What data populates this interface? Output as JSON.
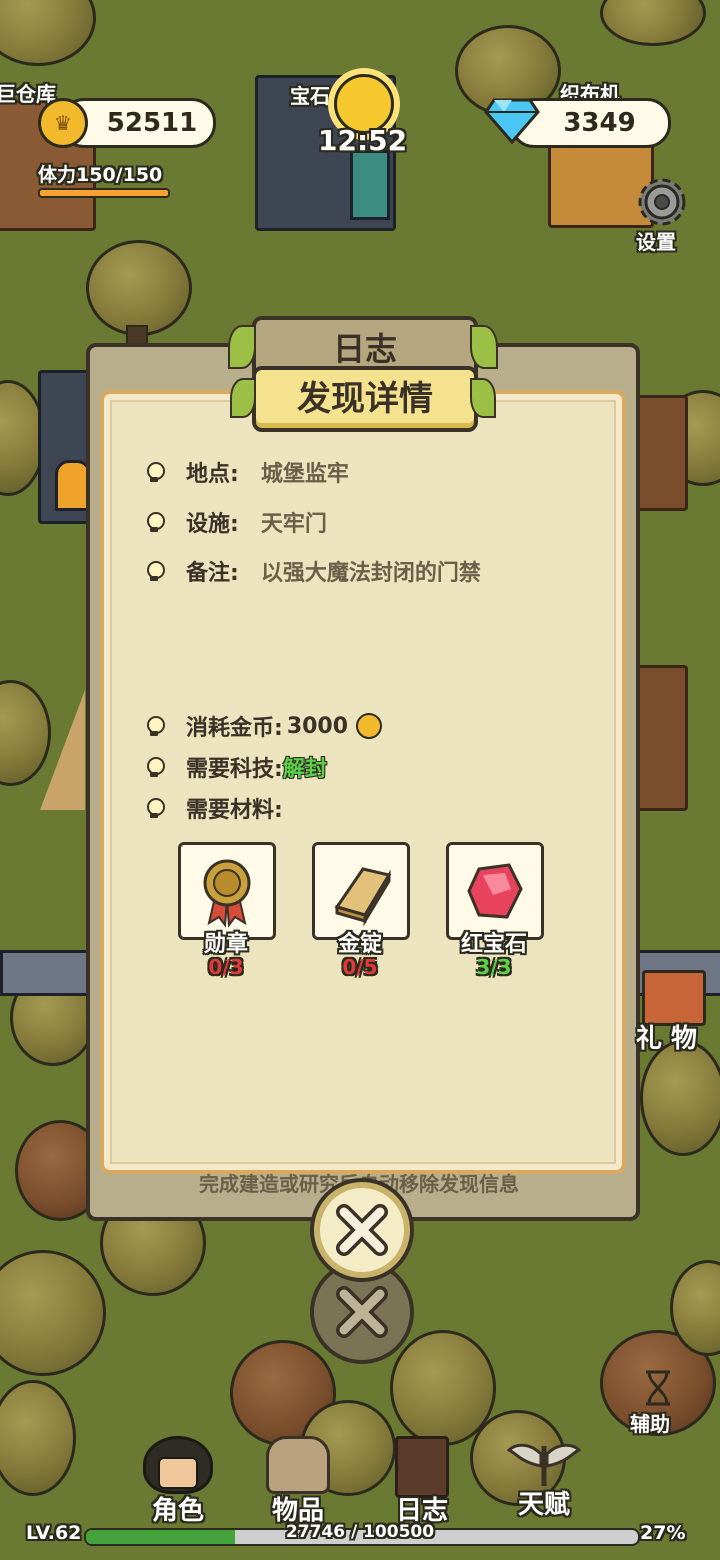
{
  "hud": {
    "warehouse_label": "巨仓库",
    "coins": "52511",
    "stamina": "体力150/150",
    "gem_building_label": "宝石",
    "time": "12:52",
    "loom_label": "织布机",
    "diamonds": "3349",
    "settings_label": "设置"
  },
  "dialog": {
    "tab_back": "日志",
    "title": "发现详情",
    "location_label": "地点:",
    "location_value": "城堡监牢",
    "facility_label": "设施:",
    "facility_value": "天牢门",
    "note_label": "备注:",
    "note_value": "以强大魔法封闭的门禁",
    "cost_label": "消耗金币:",
    "cost_value": "3000",
    "tech_label": "需要科技:",
    "tech_value": "解封",
    "materials_label": "需要材料:",
    "materials": [
      {
        "name": "勋章",
        "count": "0/3",
        "status_color": "#e03a3a",
        "icon": "medal-icon"
      },
      {
        "name": "金锭",
        "count": "0/5",
        "status_color": "#e03a3a",
        "icon": "gold-ingot-icon"
      },
      {
        "name": "红宝石",
        "count": "3/3",
        "status_color": "#5cd04a",
        "icon": "ruby-icon"
      }
    ],
    "footer_hint": "完成建造或研究后自动移除发现信息"
  },
  "side": {
    "gift_label": "礼 物",
    "assist_label": "辅助"
  },
  "bottom_nav": [
    {
      "label": "角色",
      "icon": "character-icon"
    },
    {
      "label": "物品",
      "icon": "backpack-icon"
    },
    {
      "label": "日志",
      "icon": "journal-icon"
    },
    {
      "label": "天赋",
      "icon": "wings-icon"
    }
  ],
  "level": {
    "label": "LV.62",
    "xp": "27746 / 100500",
    "percent_text": "27%",
    "progress": 0.27
  },
  "colors": {
    "grass": "#6a7a33",
    "panel_border": "#3a3226",
    "accent_gold": "#e8b630",
    "tech_green": "#5cd04a",
    "missing_red": "#e03a3a"
  }
}
